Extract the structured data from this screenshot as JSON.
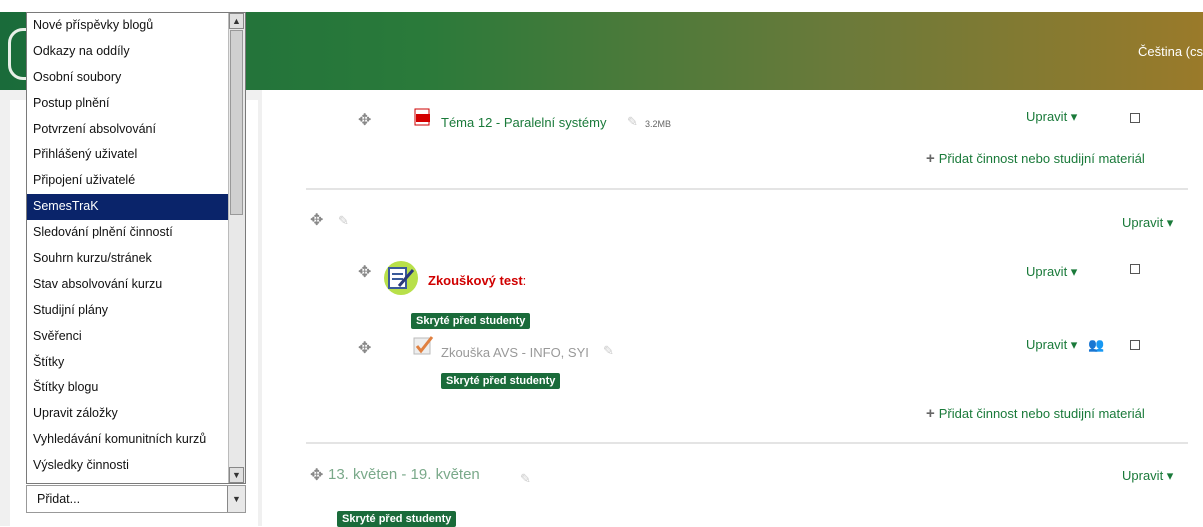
{
  "header": {
    "language": "Čeština (cs"
  },
  "dropdown": {
    "items": [
      "Nové příspěvky blogů",
      "Odkazy na oddíly",
      "Osobní soubory",
      "Postup plnění",
      "Potvrzení absolvování",
      "Přihlášený uživatel",
      "Připojení uživatelé",
      "SemesTraK",
      "Sledování plnění činností",
      "Souhrn kurzu/stránek",
      "Stav absolvování kurzu",
      "Studijní plány",
      "Svěřenci",
      "Štítky",
      "Štítky blogu",
      "Upravit záložky",
      "Vyhledávání komunitních kurzů",
      "Výsledky činnosti"
    ],
    "selected": "SemesTraK"
  },
  "select": {
    "value": "Přidat..."
  },
  "main": {
    "topic12": {
      "title": "Téma 12 - Paralelní systémy",
      "size": "3.2MB",
      "edit": "Upravit"
    },
    "add_activity": "Přidat činnost nebo studijní materiál",
    "section_edit": "Upravit",
    "quiz": {
      "title": "Zkouškový test",
      "suffix": ":",
      "edit": "Upravit"
    },
    "hidden_badge": "Skryté před studenty",
    "exam": {
      "title": "Zkouška AVS - INFO, SYI",
      "edit": "Upravit"
    },
    "week": {
      "title": "13. květen - 19. květen",
      "edit": "Upravit"
    }
  },
  "colors": {
    "accent": "#1a7a3a",
    "selected": "#0a246a",
    "badge": "#1a6b3a",
    "quiz_red": "#d00000"
  }
}
